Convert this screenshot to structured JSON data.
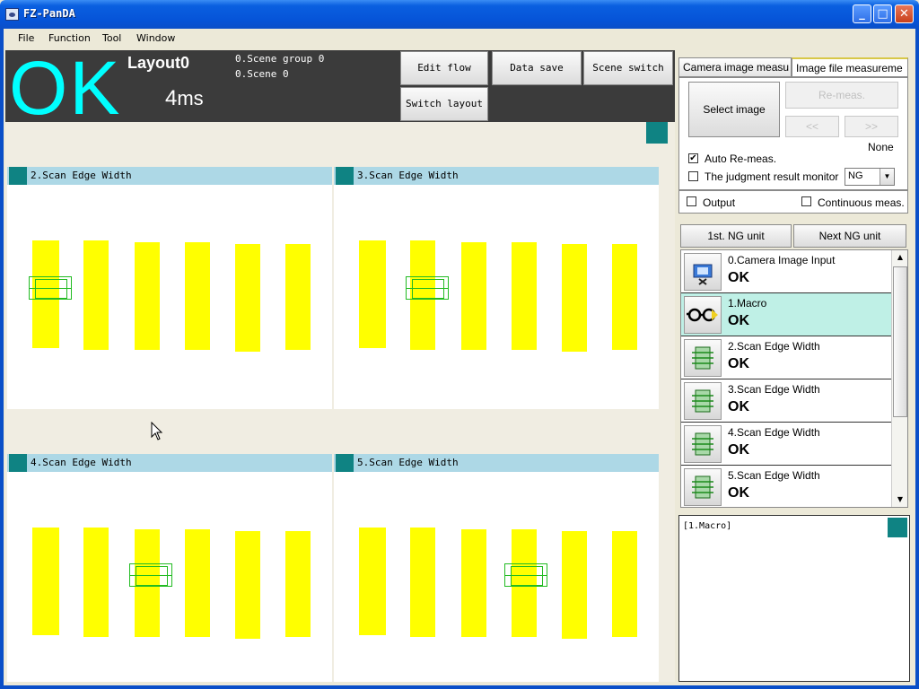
{
  "window": {
    "title": "FZ-PanDA"
  },
  "menu": [
    "File",
    "Function",
    "Tool",
    "Window"
  ],
  "status": {
    "judgement": "OK",
    "layout": "Layout0",
    "time_value": "4",
    "time_unit": "ms",
    "scene_group": "0.Scene group 0",
    "scene": "0.Scene 0"
  },
  "header_buttons": {
    "edit_flow": "Edit flow",
    "data_save": "Data save",
    "scene_switch": "Scene switch",
    "switch_layout": "Switch layout"
  },
  "panels": [
    {
      "label": "2.Scan Edge Width"
    },
    {
      "label": "3.Scan Edge Width"
    },
    {
      "label": "4.Scan Edge Width"
    },
    {
      "label": "5.Scan Edge Width"
    }
  ],
  "right": {
    "tab_camera": "Camera image measu",
    "tab_file": "Image file measureme",
    "select_image": "Select image",
    "remeas": "Re-meas.",
    "prev": "<<",
    "next": ">>",
    "none_label": "None",
    "auto_remeas": "Auto Re-meas.",
    "auto_remeas_checked": "✔",
    "judgment_monitor": "The judgment result monitor",
    "judgment_value": "NG",
    "output": "Output",
    "continuous": "Continuous meas.",
    "first_ng": "1st. NG unit",
    "next_ng": "Next NG unit"
  },
  "flow": [
    {
      "name": "0.Camera Image Input",
      "result": "OK",
      "icon": "camera-input-icon"
    },
    {
      "name": "1.Macro",
      "result": "OK",
      "icon": "macro-glasses-icon"
    },
    {
      "name": "2.Scan Edge Width",
      "result": "OK",
      "icon": "scan-edge-width-icon"
    },
    {
      "name": "3.Scan Edge Width",
      "result": "OK",
      "icon": "scan-edge-width-icon"
    },
    {
      "name": "4.Scan Edge Width",
      "result": "OK",
      "icon": "scan-edge-width-icon"
    },
    {
      "name": "5.Scan Edge Width",
      "result": "OK",
      "icon": "scan-edge-width-icon"
    }
  ],
  "detail": {
    "text": "[1.Macro]"
  },
  "colors": {
    "ok": "#00ffff",
    "teal": "#0f8383",
    "panel_head": "#add8e6",
    "bar": "#ffff00",
    "selected": "#bff0e6"
  }
}
